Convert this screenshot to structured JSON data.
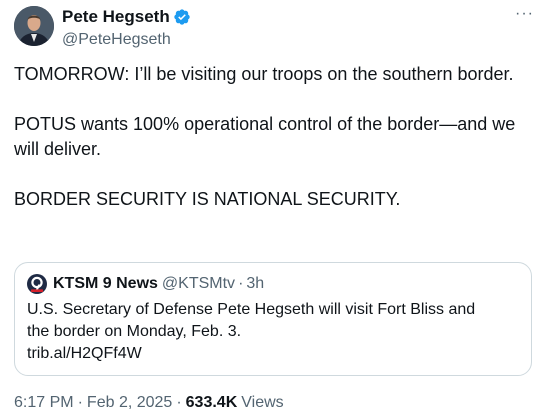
{
  "author": {
    "display_name": "Pete Hegseth",
    "handle": "@PeteHegseth",
    "more_label": "···"
  },
  "tweet": {
    "paragraphs": [
      "TOMORROW: I’ll be visiting our troops on the southern border.",
      "POTUS wants 100% operational control of the border—and we will deliver.",
      "BORDER SECURITY IS NATIONAL SECURITY."
    ]
  },
  "quote": {
    "name": "KTSM 9 News",
    "handle": "@KTSMtv",
    "dot": "·",
    "time": "3h",
    "text_line1": "U.S. Secretary of Defense Pete Hegseth will visit Fort Bliss and",
    "text_line2": "the border on Monday, Feb. 3.",
    "link": "trib.al/H2QFf4W"
  },
  "meta": {
    "time": "6:17 PM",
    "sep1": "·",
    "date": "Feb 2, 2025",
    "sep2": "·",
    "views_count": "633.4K",
    "views_label": "Views"
  },
  "colors": {
    "text": "#0f1419",
    "secondary": "#536471",
    "verified": "#1d9bf0",
    "border": "#cfd9de"
  }
}
